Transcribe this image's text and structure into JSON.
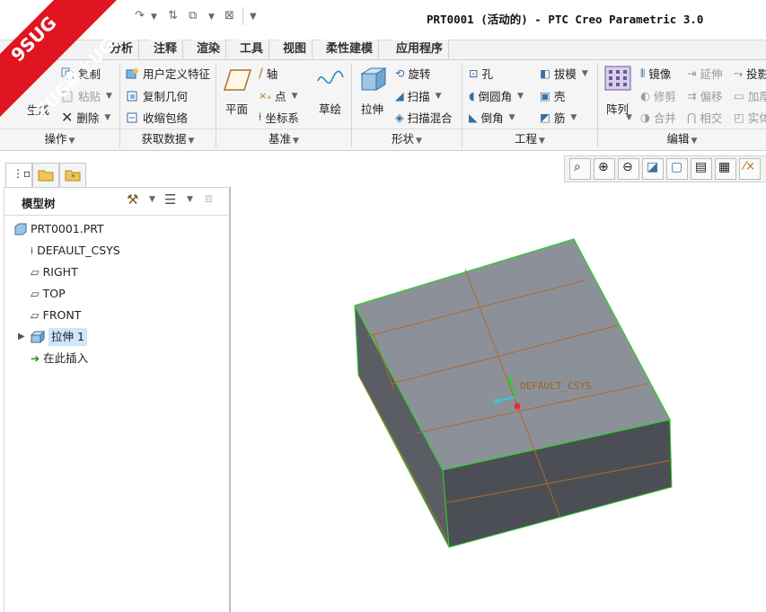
{
  "window": {
    "title": "PRT0001 (活动的) - PTC Creo Parametric 3.0"
  },
  "watermark": {
    "line1": "9SUG",
    "line2": "学UG就上UG网",
    "color": "#e0151f"
  },
  "tabs": [
    "分析",
    "注释",
    "渲染",
    "工具",
    "视图",
    "柔性建模",
    "应用程序"
  ],
  "ribbon": {
    "operations": {
      "copy": "复制",
      "paste": "粘贴",
      "regen": "生成",
      "delete": "删除",
      "group": "操作"
    },
    "get_data": {
      "udf": "用户定义特征",
      "copy_geom": "复制几何",
      "shrinkwrap": "收缩包络",
      "group": "获取数据"
    },
    "datum": {
      "plane": "平面",
      "axis": "轴",
      "point": "点",
      "csys": "坐标系",
      "sketch": "草绘",
      "group": "基准"
    },
    "shapes": {
      "extrude": "拉伸",
      "revolve": "旋转",
      "sweep": "扫描",
      "swept_blend": "扫描混合",
      "group": "形状"
    },
    "engineering": {
      "hole": "孔",
      "round": "倒圆角",
      "chamfer": "倒角",
      "draft": "拔模",
      "shell": "壳",
      "rib": "筋",
      "group": "工程"
    },
    "editing": {
      "pattern": "阵列",
      "mirror": "镜像",
      "trim": "修剪",
      "merge": "合并",
      "extend": "延伸",
      "offset": "偏移",
      "intersect": "相交",
      "project": "投影",
      "thicken": "加厚",
      "solidify": "实体化",
      "group": "编辑"
    }
  },
  "model_tree": {
    "title": "模型树",
    "root": "PRT0001.PRT",
    "items": [
      "DEFAULT_CSYS",
      "RIGHT",
      "TOP",
      "FRONT",
      "拉伸 1",
      "在此插入"
    ]
  },
  "viewport": {
    "csys_label": "DEFAULT_CSYS",
    "colors": {
      "top_face": "#8c9199",
      "side_face": "#4b4f55",
      "edge": "#2fcf2f",
      "sketch": "#b06a2a"
    }
  }
}
